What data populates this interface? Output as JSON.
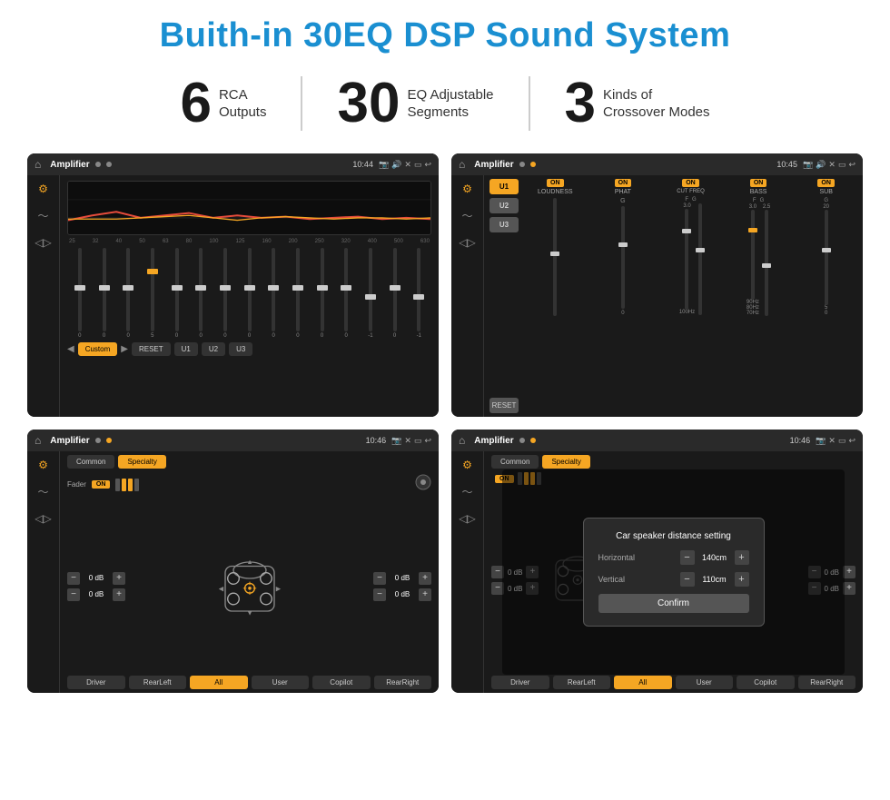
{
  "page": {
    "title": "Buith-in 30EQ DSP Sound System",
    "background": "#ffffff"
  },
  "stats": [
    {
      "number": "6",
      "label": "RCA\nOutputs"
    },
    {
      "number": "30",
      "label": "EQ Adjustable\nSegments"
    },
    {
      "number": "3",
      "label": "Kinds of\nCrossover Modes"
    }
  ],
  "screens": [
    {
      "id": "eq-screen",
      "topbar": {
        "title": "Amplifier",
        "time": "10:44"
      }
    },
    {
      "id": "mixer-screen",
      "topbar": {
        "title": "Amplifier",
        "time": "10:45"
      },
      "presets": [
        "U1",
        "U2",
        "U3"
      ],
      "channels": [
        "LOUDNESS",
        "PHAT",
        "CUT FREQ",
        "BASS",
        "SUB"
      ],
      "toggles": [
        "ON",
        "ON",
        "ON",
        "ON",
        "ON"
      ]
    },
    {
      "id": "specialty-screen",
      "topbar": {
        "title": "Amplifier",
        "time": "10:46"
      },
      "tabs": [
        "Common",
        "Specialty"
      ],
      "fader_label": "Fader",
      "fader_on": "ON",
      "controls": {
        "left": [
          {
            "label": "0 dB"
          },
          {
            "label": "0 dB"
          }
        ],
        "right": [
          {
            "label": "0 dB"
          },
          {
            "label": "0 dB"
          }
        ]
      },
      "bottom_btns": [
        "Driver",
        "RearLeft",
        "All",
        "User",
        "Copilot",
        "RearRight"
      ]
    },
    {
      "id": "dialog-screen",
      "topbar": {
        "title": "Amplifier",
        "time": "10:46"
      },
      "tabs": [
        "Common",
        "Specialty"
      ],
      "dialog": {
        "title": "Car speaker distance setting",
        "horizontal_label": "Horizontal",
        "horizontal_val": "140cm",
        "vertical_label": "Vertical",
        "vertical_val": "110cm",
        "confirm_label": "Confirm"
      },
      "bottom_btns": [
        "Driver",
        "RearLeft",
        "All",
        "User",
        "Copilot",
        "RearRight"
      ]
    }
  ],
  "eq": {
    "freqs": [
      "25",
      "32",
      "40",
      "50",
      "63",
      "80",
      "100",
      "125",
      "160",
      "200",
      "250",
      "320",
      "400",
      "500",
      "630"
    ],
    "values": [
      "0",
      "0",
      "0",
      "5",
      "0",
      "0",
      "0",
      "0",
      "0",
      "0",
      "0",
      "0",
      "-1",
      "0",
      "-1"
    ],
    "presets": [
      "Custom",
      "RESET",
      "U1",
      "U2",
      "U3"
    ]
  }
}
